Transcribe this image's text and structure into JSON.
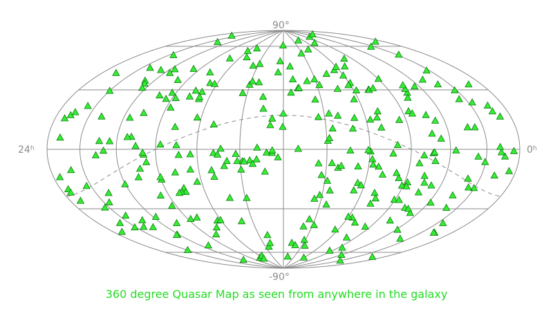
{
  "caption": "360 degree Quasar Map as seen from anywhere in the galaxy",
  "labels": {
    "north_pole": "90°",
    "south_pole": "-90°",
    "left_edge_base": "24",
    "left_edge_sup": "h",
    "right_edge_base": "0",
    "right_edge_sup": "h"
  },
  "colors": {
    "grid": "#8a8a8a",
    "marker_fill": "#33ee33",
    "marker_stroke": "#117711",
    "caption": "#22dd22"
  },
  "projection": "Aitoff / Hammer all-sky",
  "marker_shape": "triangle-icon",
  "quasar_count": 300
}
